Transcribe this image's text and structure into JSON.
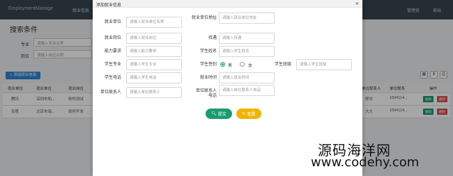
{
  "app": {
    "brand": "EmploymentManage",
    "nav_first": "就业信息",
    "nav_admin": "管理员",
    "nav_logout": "退出"
  },
  "background": {
    "section_title": "搜索条件",
    "filters": [
      {
        "label": "专业",
        "placeholder": "请输入专业名称"
      },
      {
        "label": "岗位",
        "placeholder": "请输入岗位名称"
      }
    ],
    "add_button": "添加就业信息",
    "table": {
      "headers_left": [
        "就业单位",
        "就业单位",
        "就业岗位"
      ],
      "headers_right": [
        "单位联系人",
        "单位联系",
        "操作"
      ],
      "rows": [
        {
          "unit": "腾讯",
          "addr": "深圳市和...",
          "job": "软件测试",
          "contact": "舒甘",
          "phone": "1594114..."
        },
        {
          "unit": "百度",
          "addr": "北京市海...",
          "job": "软件开发",
          "contact": "大大",
          "phone": "1594114..."
        }
      ],
      "edit_label": "编辑",
      "delete_label": "删除"
    }
  },
  "modal": {
    "title": "添加就业信息",
    "close": "×",
    "fields": {
      "unit": {
        "label": "就业单位",
        "placeholder": "请输入就业单位名称"
      },
      "unit_addr": {
        "label": "就业单位地址",
        "placeholder": "请输入就业单位地址"
      },
      "job": {
        "label": "就业岗位",
        "placeholder": "请输入就业岗位"
      },
      "treatment": {
        "label": "待遇",
        "placeholder": "请输入待遇"
      },
      "ability": {
        "label": "能力要求",
        "placeholder": "请输入能力要求"
      },
      "student_name": {
        "label": "学生姓名",
        "placeholder": "请输入学生姓名"
      },
      "major": {
        "label": "学生专业",
        "placeholder": "请输入学生专业"
      },
      "gender": {
        "label": "学生性别",
        "male": "男",
        "female": "女",
        "selected": "男"
      },
      "class_name": {
        "label": "学生班级",
        "placeholder": "请输入学生班级"
      },
      "phone": {
        "label": "学生电话",
        "placeholder": "请输入学生电话"
      },
      "emp_time": {
        "label": "就业时间",
        "placeholder": "请输入就业时间"
      },
      "contact": {
        "label": "单位联系人",
        "placeholder": "请输入单位联系人"
      },
      "contact_phone": {
        "label": "单位联系人电话",
        "placeholder": "请输入单位联系人电话"
      }
    },
    "submit_label": "提交",
    "reset_label": "重置"
  },
  "watermark": {
    "line1": "源码海洋网",
    "line2": "www.codehy.com"
  },
  "colors": {
    "primary": "#1a9c73",
    "warning": "#f0b400",
    "topbar": "#3a4550",
    "add_button": "#2f86d6"
  }
}
